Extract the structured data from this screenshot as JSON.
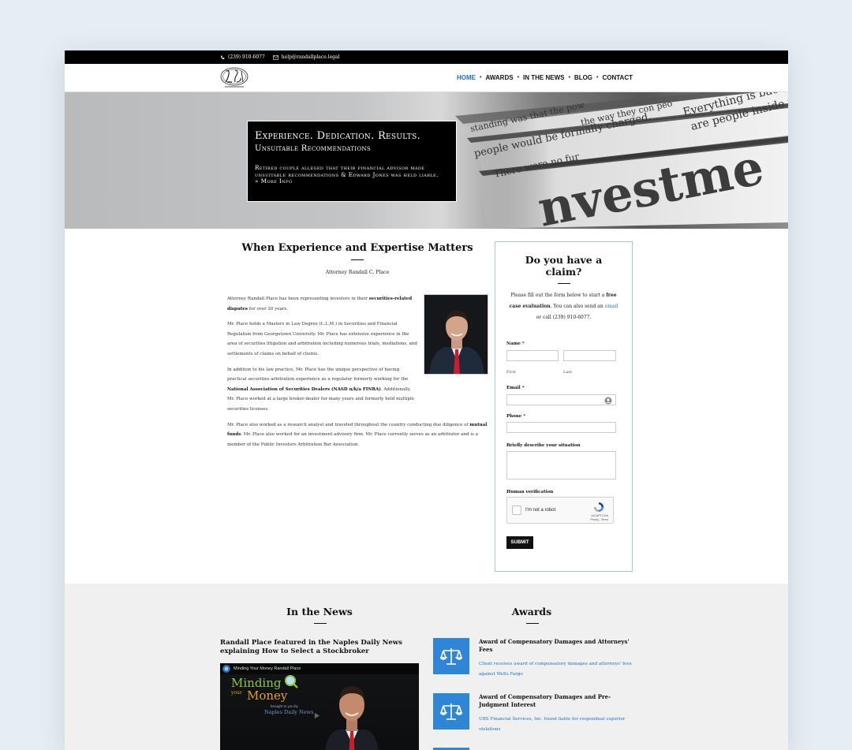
{
  "topbar": {
    "phone": "(239) 910-6077",
    "email": "help@randallplace.legal"
  },
  "nav": {
    "items": [
      {
        "label": "HOME",
        "active": true
      },
      {
        "label": "AWARDS",
        "active": false
      },
      {
        "label": "IN THE NEWS",
        "active": false
      },
      {
        "label": "BLOG",
        "active": false
      },
      {
        "label": "CONTACT",
        "active": false
      }
    ]
  },
  "hero": {
    "title": "Experience. Dedication. Results.",
    "subtitle": "Unsuitable Recommendations",
    "description": "Retired couple alleged that their financial advisor made unsuitable recommendations & Edward Jones was held liable.",
    "more": "» More Info",
    "newspaper_text": [
      "Everything is back to",
      "are people inside pray",
      "standing was that the pow",
      "the way they con peo",
      "people would be formally charged.",
      "There were no fur",
      "nvestme"
    ]
  },
  "main": {
    "heading": "When Experience and Expertise Matters",
    "attorney": "Attorney Randall C. Place",
    "bio": [
      {
        "parts": [
          "Attorney Randall Place has been representing investors in their ",
          "securities-related disputes",
          " for over 20 years."
        ]
      },
      {
        "parts": [
          "Mr. Place holds a Masters in Law Degree (L.L.M.) in Securities and Financial Regulation from Georgetown University. Mr. Place has extensive experience in the area of securities litigation and arbitration including numerous trials, mediations, and settlements of claims on behalf of clients."
        ]
      },
      {
        "parts": [
          "In addition to his law practice, Mr. Place has the unique perspective of having practical securities arbitration experience as a regulator formerly working for the ",
          "National Association of Securities Dealers (NASD n/k/a FINRA)",
          ". Additionally, Mr. Place worked at a large broker-dealer for many years and formerly held multiple securities licenses."
        ]
      },
      {
        "parts": [
          "Mr. Place also worked as a research analyst and traveled throughout the country conducting due diligence of ",
          "mutual funds",
          ". Mr. Place also worked for an investment advisory firm. Mr. Place currently serves as an arbitrator and is a member of the Public Investors Arbitration Bar Association."
        ]
      }
    ]
  },
  "claim": {
    "title": "Do you have a claim?",
    "intro_1": "Please fill out the form below to start a ",
    "intro_bold": "free case evaluation",
    "intro_2": ". You can also send an ",
    "intro_link": "email",
    "intro_3": " or call (239) 910-6077.",
    "name_label": "Name",
    "first_hint": "First",
    "last_hint": "Last",
    "email_label": "Email",
    "phone_label": "Phone",
    "describe_label": "Briefly describe your situation",
    "verify_label": "Human verification",
    "recaptcha_text": "I'm not a robot",
    "recaptcha_brand": "reCAPTCHA",
    "recaptcha_links": "Privacy - Terms",
    "submit": "SUBMIT"
  },
  "news": {
    "title": "In the News",
    "headline": "Randall Place featured in the Naples Daily News explaining How to Select a Stockbroker",
    "video_title": "Minding Your Money Randall Place",
    "video_logo_1": "Minding",
    "video_logo_2": "your",
    "video_logo_3": "Money",
    "video_sub": "brought to you by",
    "video_brand": "Naples Daily News"
  },
  "awards": {
    "title": "Awards",
    "items": [
      {
        "title": "Award of Compensatory Damages and Attorneys' Fees",
        "desc": "Client receives award of compensatory damages and attorneys' fees against Wells Fargo"
      },
      {
        "title": "Award of Compensatory Damages and Pre-Judgment Interest",
        "desc": "UBS Financial Services, Inc. found liable for respondeat superior violations"
      }
    ]
  }
}
